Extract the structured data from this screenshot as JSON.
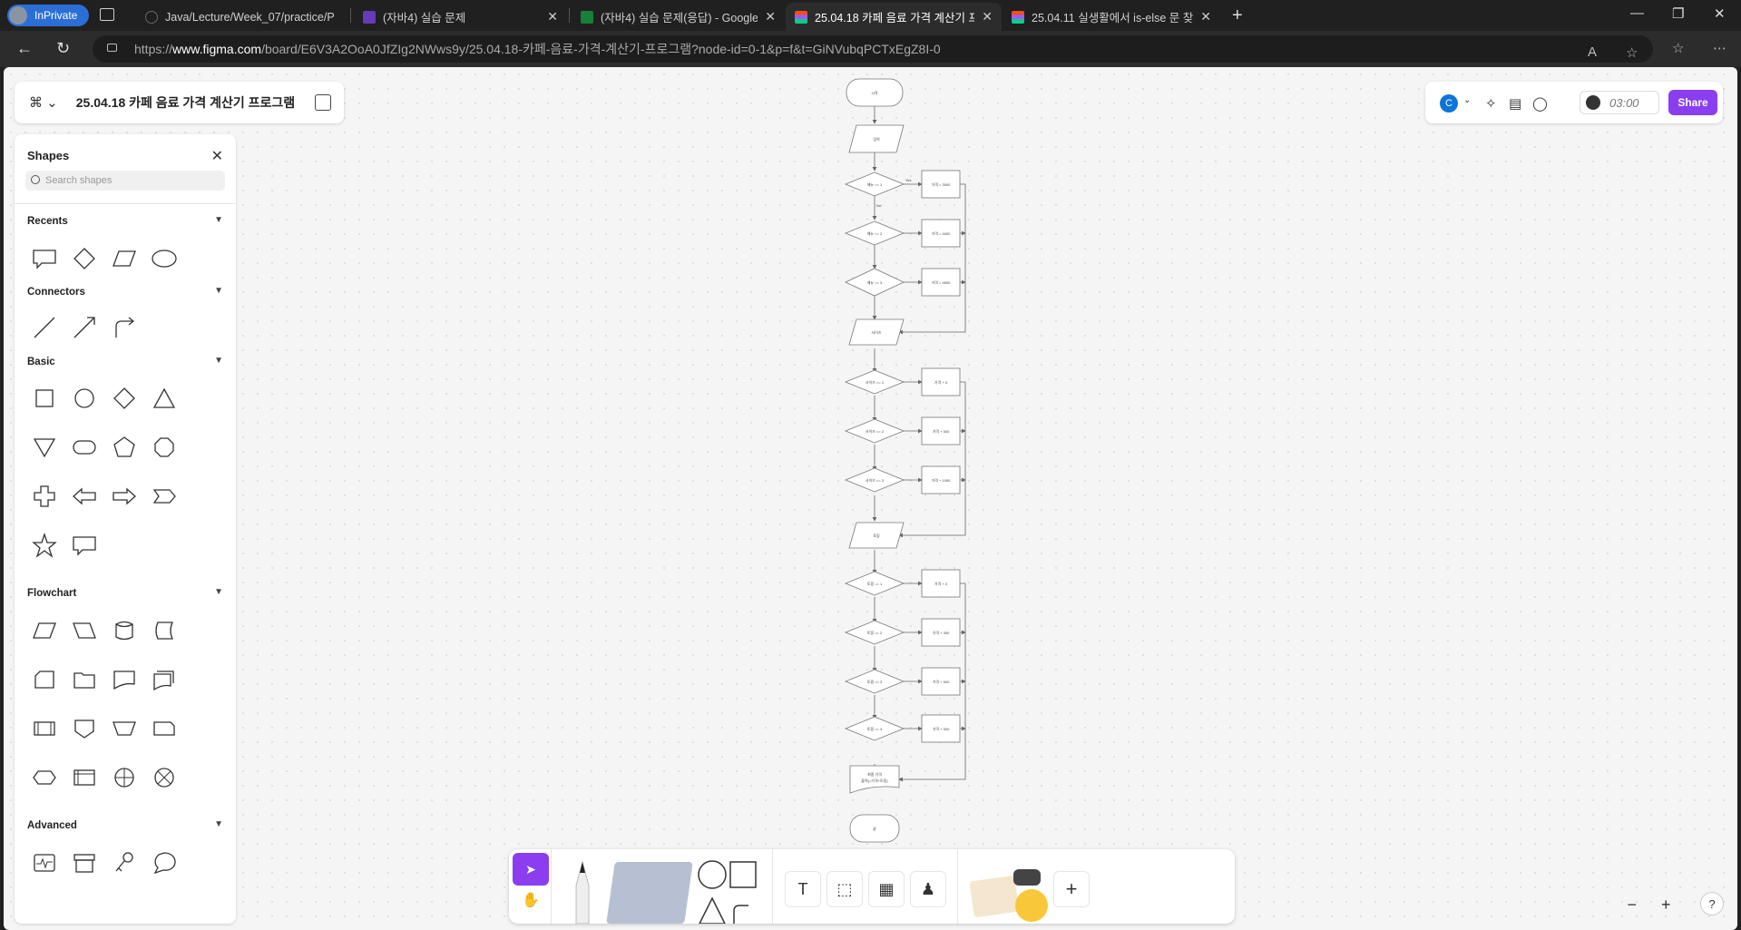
{
  "browser": {
    "profile_label": "InPrivate",
    "tabs": [
      {
        "title": "Java/Lecture/Week_07/practice/P",
        "favicon_color": "#1f1f1f"
      },
      {
        "title": "(자바4) 실습 문제",
        "favicon_color": "#673ab7"
      },
      {
        "title": "(자바4) 실습 문제(응답) - Google",
        "favicon_color": "#188038"
      },
      {
        "title": "25.04.18 카페 음료 가격 계산기 프",
        "favicon_color": "#a259ff"
      },
      {
        "title": "25.04.11 실생활에서 is-else 문 찾",
        "favicon_color": "#a259ff"
      }
    ],
    "url_host": "www.figma.com",
    "url_prefix": "https://",
    "url_path": "/board/E6V3A2OoA0JfZIg2NWws9y/25.04.18-카페-음료-가격-계산기-프로그램?node-id=0-1&p=f&t=GiNVubqPCTxEgZ8I-0"
  },
  "file": {
    "name": "25.04.18 카페 음료 가격 계산기 프로그램"
  },
  "shapes_panel": {
    "title": "Shapes",
    "search_placeholder": "Search shapes",
    "sections": {
      "recents": "Recents",
      "connectors": "Connectors",
      "basic": "Basic",
      "flowchart": "Flowchart",
      "advanced": "Advanced"
    }
  },
  "topbar": {
    "avatar_letter": "C",
    "timer": "03:00",
    "share_label": "Share"
  },
  "flowchart": {
    "start": "시작",
    "input_menu": "입력",
    "menu_decisions": [
      "메뉴 == 1",
      "메뉴 == 2",
      "메뉴 == 3"
    ],
    "menu_results": [
      "가격 = 3000",
      "가격 = 4000",
      "가격 = 4500"
    ],
    "input_size": "사이즈",
    "size_decisions": [
      "사이즈 == 1",
      "사이즈 == 2",
      "사이즈 == 3"
    ],
    "size_results": [
      "가격 + 0",
      "가격 + 500",
      "가격 + 1000"
    ],
    "input_topping": "토핑",
    "topping_decisions": [
      "토핑 == 1",
      "토핑 == 2",
      "토핑 == 3",
      "토핑 == 4"
    ],
    "topping_results": [
      "가격 + 0",
      "가격 + 300",
      "가격 + 500",
      "가격 + 500"
    ],
    "output_line1": "최종 가격",
    "output_line2": "출력(=가격+토핑)",
    "end": "끝",
    "yes": "Yes",
    "no": "No"
  },
  "zoom": {
    "minus": "−",
    "plus": "+",
    "help": "?"
  }
}
